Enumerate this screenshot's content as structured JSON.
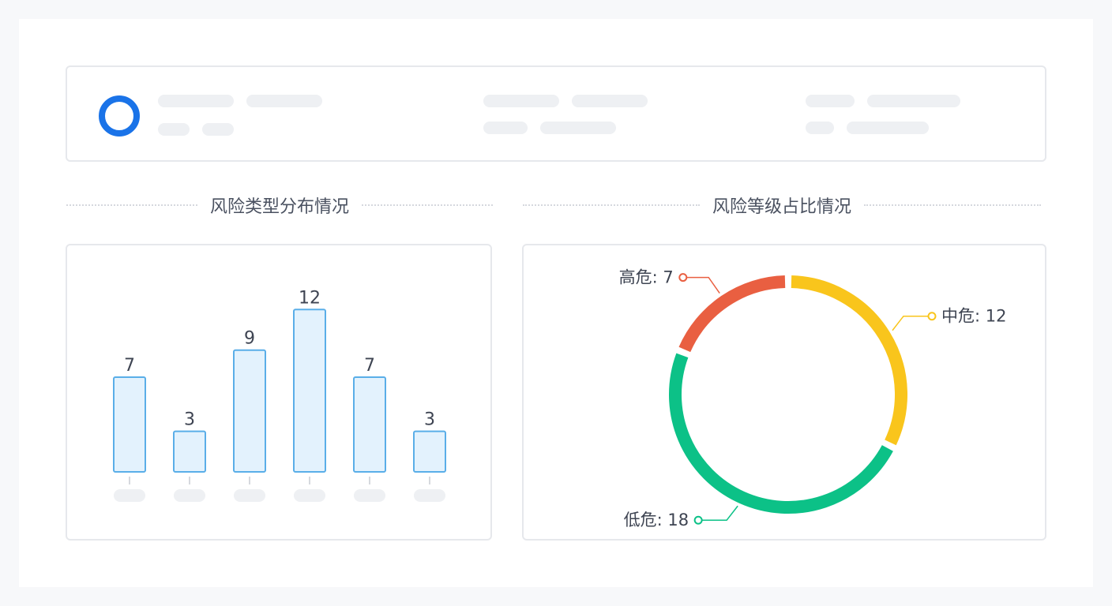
{
  "sections": {
    "left_title": "风险类型分布情况",
    "right_title": "风险等级占比情况"
  },
  "colors": {
    "accent_blue": "#1a73e8",
    "bar_fill": "#e3f2fd",
    "bar_stroke": "#5aaee8",
    "high": "#e95f41",
    "medium": "#f9c51c",
    "low": "#0cc187"
  },
  "chart_data": [
    {
      "type": "bar",
      "title": "风险类型分布情况",
      "categories": [
        "",
        "",
        "",
        "",
        "",
        ""
      ],
      "values": [
        7,
        3,
        9,
        12,
        7,
        3
      ],
      "ylim": [
        0,
        14
      ]
    },
    {
      "type": "pie",
      "title": "风险等级占比情况",
      "slices": [
        {
          "name": "中危",
          "value": 12,
          "label": "中危: 12"
        },
        {
          "name": "低危",
          "value": 18,
          "label": "低危: 18"
        },
        {
          "name": "高危",
          "value": 7,
          "label": "高危: 7"
        }
      ]
    }
  ]
}
